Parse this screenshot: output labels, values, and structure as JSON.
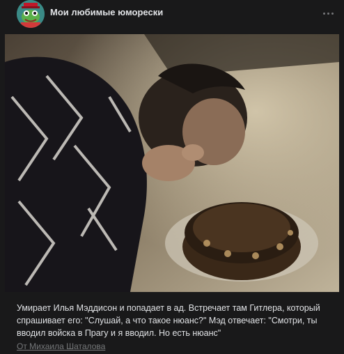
{
  "community": {
    "name": "Мои любимые юморески",
    "avatar_icon": "frog-avatar-icon"
  },
  "menu": {
    "icon": "more-horizontal-icon"
  },
  "media": {
    "icon": "video-gif-frame"
  },
  "post": {
    "text_lines": [
      "Умирает Илья Мэддисон и попадает в ад. Встречает там Гитлера, который",
      "спрашивает его: \"Слушай, а что такое нюанс?\" Мэд отвечает: \"Смотри, ты",
      "вводил войска в Прагу и я вводил. Но есть нюанс\""
    ],
    "author": "От Михаила Шаталова"
  },
  "colors": {
    "background": "#19191a",
    "text": "#e1e3e6",
    "muted": "#76787a",
    "avatar_bg": "#3a8a86"
  }
}
